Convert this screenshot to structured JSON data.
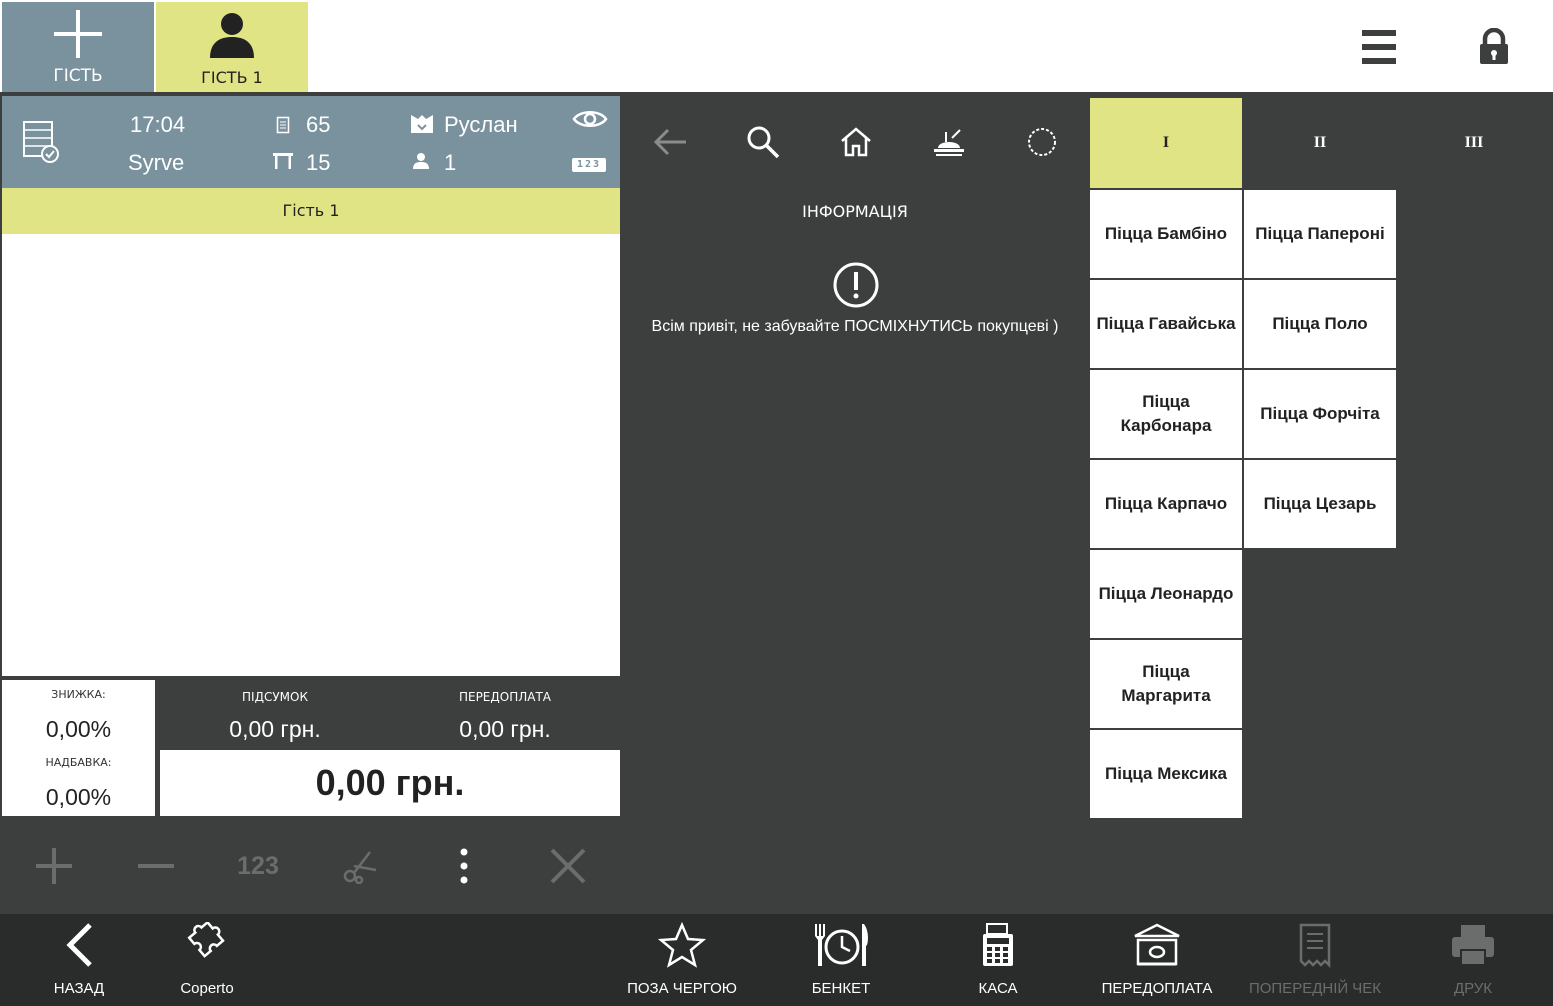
{
  "tabs": {
    "add_label": "ГІСТЬ",
    "guest_label": "ГІСТЬ 1"
  },
  "order_info": {
    "time": "17:04",
    "restaurant": "Syrve",
    "order_number": "65",
    "table_number": "15",
    "waiter": "Руслан",
    "guests_count": "1",
    "numbers_badge": "123"
  },
  "guest_strip": "Гість 1",
  "totals": {
    "discount_label": "ЗНИЖКА:",
    "discount_value": "0,00%",
    "surcharge_label": "НАДБАВКА:",
    "surcharge_value": "0,00%",
    "subtotal_label": "ПІДСУМОК",
    "subtotal_value": "0,00 грн.",
    "prepay_label": "ПЕРЕДОПЛАТА",
    "prepay_value": "0,00 грн.",
    "total_value": "0,00 грн."
  },
  "tools": {
    "quantity_label": "123"
  },
  "info": {
    "title": "ІНФОРМАЦІЯ",
    "message": "Всім привіт, не забувайте ПОСМІХНУТИСЬ покупцеві )"
  },
  "categories": [
    "I",
    "II",
    "III"
  ],
  "products": {
    "col1": [
      "Піцца Бамбіно",
      "Піцца Гавайська",
      "Піцца Карбонара",
      "Піцца Карпачо",
      "Піцца Леонардо",
      "Піцца Маргарита",
      "Піцца Мексика"
    ],
    "col2": [
      "Піцца Папероні",
      "Піцца Поло",
      "Піцца Форчіта",
      "Піцца Цезарь"
    ]
  },
  "bottom": {
    "back": "НАЗАД",
    "coperto": "Coperto",
    "priority": "ПОЗА ЧЕРГОЮ",
    "banquet": "БЕНКЕТ",
    "cash": "КАСА",
    "prepay": "ПЕРЕДОПЛАТА",
    "prev_check": "ПОПЕРЕДНІЙ ЧЕК",
    "print": "ДРУК"
  },
  "colors": {
    "accent_yellow": "#e1e485",
    "slate_blue": "#7a929e",
    "dark_bg": "#3d3f3f",
    "bottom_bg": "#2a2b2b"
  }
}
